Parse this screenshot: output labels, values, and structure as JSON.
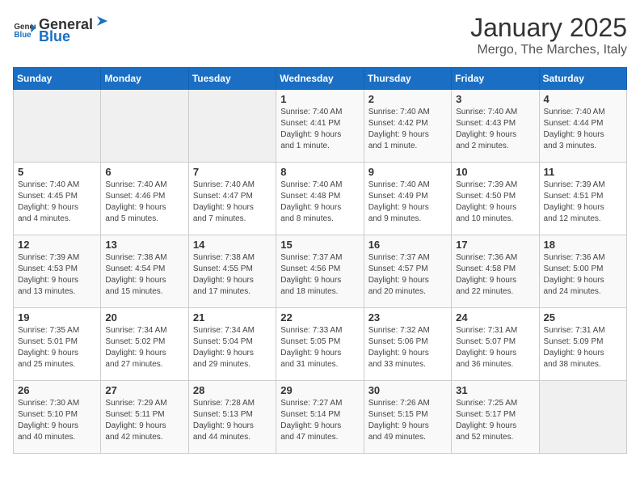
{
  "header": {
    "logo_general": "General",
    "logo_blue": "Blue",
    "month": "January 2025",
    "location": "Mergo, The Marches, Italy"
  },
  "weekdays": [
    "Sunday",
    "Monday",
    "Tuesday",
    "Wednesday",
    "Thursday",
    "Friday",
    "Saturday"
  ],
  "weeks": [
    [
      {
        "day": "",
        "info": ""
      },
      {
        "day": "",
        "info": ""
      },
      {
        "day": "",
        "info": ""
      },
      {
        "day": "1",
        "info": "Sunrise: 7:40 AM\nSunset: 4:41 PM\nDaylight: 9 hours\nand 1 minute."
      },
      {
        "day": "2",
        "info": "Sunrise: 7:40 AM\nSunset: 4:42 PM\nDaylight: 9 hours\nand 1 minute."
      },
      {
        "day": "3",
        "info": "Sunrise: 7:40 AM\nSunset: 4:43 PM\nDaylight: 9 hours\nand 2 minutes."
      },
      {
        "day": "4",
        "info": "Sunrise: 7:40 AM\nSunset: 4:44 PM\nDaylight: 9 hours\nand 3 minutes."
      }
    ],
    [
      {
        "day": "5",
        "info": "Sunrise: 7:40 AM\nSunset: 4:45 PM\nDaylight: 9 hours\nand 4 minutes."
      },
      {
        "day": "6",
        "info": "Sunrise: 7:40 AM\nSunset: 4:46 PM\nDaylight: 9 hours\nand 5 minutes."
      },
      {
        "day": "7",
        "info": "Sunrise: 7:40 AM\nSunset: 4:47 PM\nDaylight: 9 hours\nand 7 minutes."
      },
      {
        "day": "8",
        "info": "Sunrise: 7:40 AM\nSunset: 4:48 PM\nDaylight: 9 hours\nand 8 minutes."
      },
      {
        "day": "9",
        "info": "Sunrise: 7:40 AM\nSunset: 4:49 PM\nDaylight: 9 hours\nand 9 minutes."
      },
      {
        "day": "10",
        "info": "Sunrise: 7:39 AM\nSunset: 4:50 PM\nDaylight: 9 hours\nand 10 minutes."
      },
      {
        "day": "11",
        "info": "Sunrise: 7:39 AM\nSunset: 4:51 PM\nDaylight: 9 hours\nand 12 minutes."
      }
    ],
    [
      {
        "day": "12",
        "info": "Sunrise: 7:39 AM\nSunset: 4:53 PM\nDaylight: 9 hours\nand 13 minutes."
      },
      {
        "day": "13",
        "info": "Sunrise: 7:38 AM\nSunset: 4:54 PM\nDaylight: 9 hours\nand 15 minutes."
      },
      {
        "day": "14",
        "info": "Sunrise: 7:38 AM\nSunset: 4:55 PM\nDaylight: 9 hours\nand 17 minutes."
      },
      {
        "day": "15",
        "info": "Sunrise: 7:37 AM\nSunset: 4:56 PM\nDaylight: 9 hours\nand 18 minutes."
      },
      {
        "day": "16",
        "info": "Sunrise: 7:37 AM\nSunset: 4:57 PM\nDaylight: 9 hours\nand 20 minutes."
      },
      {
        "day": "17",
        "info": "Sunrise: 7:36 AM\nSunset: 4:58 PM\nDaylight: 9 hours\nand 22 minutes."
      },
      {
        "day": "18",
        "info": "Sunrise: 7:36 AM\nSunset: 5:00 PM\nDaylight: 9 hours\nand 24 minutes."
      }
    ],
    [
      {
        "day": "19",
        "info": "Sunrise: 7:35 AM\nSunset: 5:01 PM\nDaylight: 9 hours\nand 25 minutes."
      },
      {
        "day": "20",
        "info": "Sunrise: 7:34 AM\nSunset: 5:02 PM\nDaylight: 9 hours\nand 27 minutes."
      },
      {
        "day": "21",
        "info": "Sunrise: 7:34 AM\nSunset: 5:04 PM\nDaylight: 9 hours\nand 29 minutes."
      },
      {
        "day": "22",
        "info": "Sunrise: 7:33 AM\nSunset: 5:05 PM\nDaylight: 9 hours\nand 31 minutes."
      },
      {
        "day": "23",
        "info": "Sunrise: 7:32 AM\nSunset: 5:06 PM\nDaylight: 9 hours\nand 33 minutes."
      },
      {
        "day": "24",
        "info": "Sunrise: 7:31 AM\nSunset: 5:07 PM\nDaylight: 9 hours\nand 36 minutes."
      },
      {
        "day": "25",
        "info": "Sunrise: 7:31 AM\nSunset: 5:09 PM\nDaylight: 9 hours\nand 38 minutes."
      }
    ],
    [
      {
        "day": "26",
        "info": "Sunrise: 7:30 AM\nSunset: 5:10 PM\nDaylight: 9 hours\nand 40 minutes."
      },
      {
        "day": "27",
        "info": "Sunrise: 7:29 AM\nSunset: 5:11 PM\nDaylight: 9 hours\nand 42 minutes."
      },
      {
        "day": "28",
        "info": "Sunrise: 7:28 AM\nSunset: 5:13 PM\nDaylight: 9 hours\nand 44 minutes."
      },
      {
        "day": "29",
        "info": "Sunrise: 7:27 AM\nSunset: 5:14 PM\nDaylight: 9 hours\nand 47 minutes."
      },
      {
        "day": "30",
        "info": "Sunrise: 7:26 AM\nSunset: 5:15 PM\nDaylight: 9 hours\nand 49 minutes."
      },
      {
        "day": "31",
        "info": "Sunrise: 7:25 AM\nSunset: 5:17 PM\nDaylight: 9 hours\nand 52 minutes."
      },
      {
        "day": "",
        "info": ""
      }
    ]
  ]
}
